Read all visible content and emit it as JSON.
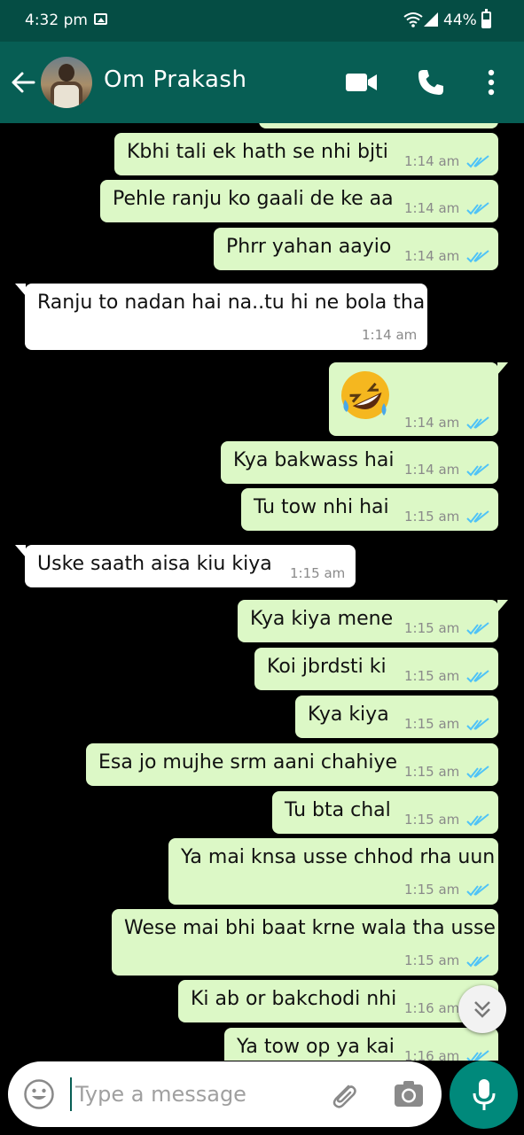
{
  "status_bar": {
    "time": "4:32 pm",
    "battery": "44%"
  },
  "header": {
    "contact_name": "Om Prakash",
    "icons": [
      "back-arrow-icon",
      "video-call-icon",
      "phone-call-icon",
      "more-options-icon"
    ]
  },
  "messages": [
    {
      "direction": "out",
      "text": "Kbhi tali ek hath se nhi bjti",
      "time": "1:14 am",
      "read": true
    },
    {
      "direction": "out",
      "text": "Pehle ranju ko gaali de ke aa",
      "time": "1:14 am",
      "read": true
    },
    {
      "direction": "out",
      "text": "Phrr yahan aayio",
      "time": "1:14 am",
      "read": true
    },
    {
      "direction": "in",
      "text": "Ranju to nadan hai na..tu hi ne bola tha",
      "time": "1:14 am"
    },
    {
      "direction": "out",
      "text": "",
      "emoji": "rolling-on-floor-laughing",
      "time": "1:14 am",
      "read": true
    },
    {
      "direction": "out",
      "text": "Kya bakwass hai",
      "time": "1:14 am",
      "read": true
    },
    {
      "direction": "out",
      "text": "Tu tow nhi  hai",
      "time": "1:15 am",
      "read": true
    },
    {
      "direction": "in",
      "text": "Uske saath aisa kiu kiya",
      "time": "1:15 am"
    },
    {
      "direction": "out",
      "text": "Kya kiya mene",
      "time": "1:15 am",
      "read": true
    },
    {
      "direction": "out",
      "text": "Koi jbrdsti ki",
      "time": "1:15 am",
      "read": true
    },
    {
      "direction": "out",
      "text": "Kya kiya",
      "time": "1:15 am",
      "read": true
    },
    {
      "direction": "out",
      "text": "Esa jo mujhe srm aani chahiye",
      "time": "1:15 am",
      "read": true
    },
    {
      "direction": "out",
      "text": "Tu bta chal",
      "time": "1:15 am",
      "read": true
    },
    {
      "direction": "out",
      "text": "Ya mai knsa usse chhod rha uun",
      "time": "1:15 am",
      "read": true
    },
    {
      "direction": "out",
      "text": "Wese mai bhi baat krne wala tha usse",
      "time": "1:15 am",
      "read": true
    },
    {
      "direction": "out",
      "text": "Ki ab or bakchodi nhi",
      "time": "1:16 am",
      "read": true
    },
    {
      "direction": "out",
      "text": "Ya tow op ya kai",
      "time": "1:16 am",
      "read": true
    }
  ],
  "composer": {
    "placeholder": "Type a message"
  },
  "colors": {
    "header": "#075e54",
    "status_bar": "#054d44",
    "outgoing_bubble": "#dcf8c6",
    "incoming_bubble": "#ffffff",
    "read_ticks": "#4fc3f7",
    "mic_button": "#00897b"
  }
}
